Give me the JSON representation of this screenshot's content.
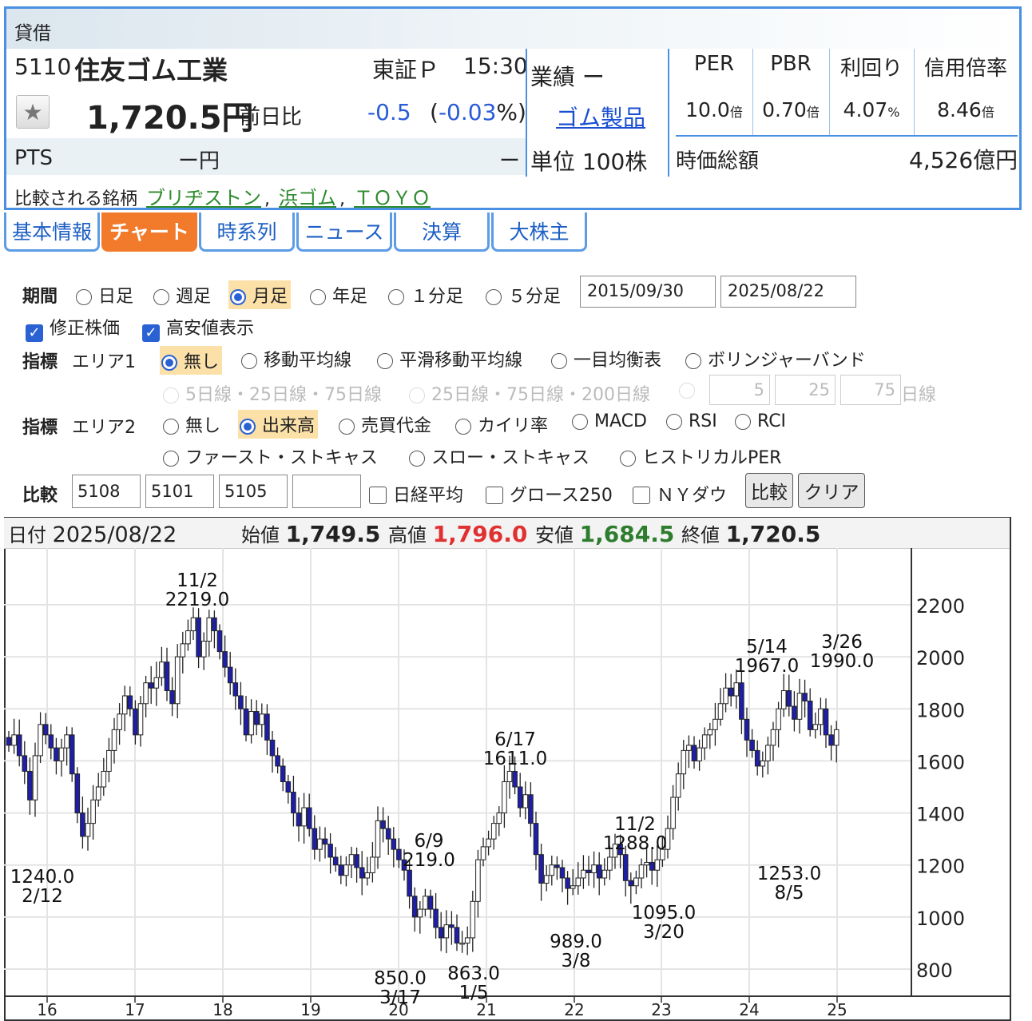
{
  "header": {
    "lending_label": "貸借",
    "code": "5110",
    "name": "住友ゴム工業",
    "exchange": "東証Ｐ",
    "time": "15:30",
    "price": "1,720.5円",
    "prev_label": "前日比",
    "change": "-0.5",
    "change_pct_open": "(",
    "change_pct": "-0.03",
    "change_pct_close": "%)",
    "pts_label": "PTS",
    "pts_value": "ー円",
    "pts_dash": "ー",
    "performance": "業績 ー",
    "sector": "ゴム製品",
    "unit": "単位 100株",
    "ratios": [
      {
        "label": "PER",
        "value": "10.0",
        "unit": "倍"
      },
      {
        "label": "PBR",
        "value": "0.70",
        "unit": "倍"
      },
      {
        "label": "利回り",
        "value": "4.07",
        "unit": "%"
      },
      {
        "label": "信用倍率",
        "value": "8.46",
        "unit": "倍"
      }
    ],
    "market_cap_label": "時価総額",
    "market_cap_value": "4,526億円",
    "compare_label": "比較される銘柄",
    "compare_links": [
      "ブリヂストン",
      "浜ゴム",
      "ＴＯＹＯ"
    ]
  },
  "tabs": [
    "基本情報",
    "チャート",
    "時系列",
    "ニュース",
    "決算",
    "大株主"
  ],
  "active_tab": "チャート",
  "options": {
    "period_label": "期間",
    "periods": [
      "日足",
      "週足",
      "月足",
      "年足",
      "１分足",
      "５分足"
    ],
    "selected_period": "月足",
    "date_from": "2015/09/30",
    "date_to": "2025/08/22",
    "adjusted_label": "修正株価",
    "highlow_label": "高安値表示",
    "indicator_label": "指標",
    "area1_label": "エリア1",
    "area1_options": [
      "無し",
      "移動平均線",
      "平滑移動平均線",
      "一目均衡表",
      "ボリンジャーバンド"
    ],
    "area1_selected": "無し",
    "ma_options": [
      "5日線・25日線・75日線",
      "25日線・75日線・200日線"
    ],
    "ma_values": [
      "5",
      "25",
      "75"
    ],
    "ma_suffix": "日線",
    "area2_label": "エリア2",
    "area2_options": [
      "無し",
      "出来高",
      "売買代金",
      "カイリ率",
      "MACD",
      "RSI",
      "RCI"
    ],
    "area2_options_row2": [
      "ファースト・ストキャス",
      "スロー・ストキャス",
      "ヒストリカルPER"
    ],
    "area2_selected": "出来高",
    "compare_label": "比較",
    "compare_codes": [
      "5108",
      "5101",
      "5105",
      ""
    ],
    "compare_indices": [
      "日経平均",
      "グロース250",
      "ＮＹダウ"
    ],
    "compare_button": "比較",
    "clear_button": "クリア"
  },
  "chart_header": {
    "date_label": "日付",
    "date": "2025/08/22",
    "open_label": "始値",
    "open": "1,749.5",
    "high_label": "高値",
    "high": "1,796.0",
    "low_label": "安値",
    "low": "1,684.5",
    "close_label": "終値",
    "close": "1,720.5"
  },
  "colors": {
    "accent": "#4a90e2",
    "up": "#ffffff",
    "down": "#1e1ea8",
    "high": "#e03030",
    "low": "#2e7d2e",
    "tab_active": "#f17a2b"
  },
  "chart_data": {
    "type": "candlestick",
    "timeframe": "monthly",
    "x_labels": [
      "16",
      "17",
      "18",
      "19",
      "20",
      "21",
      "22",
      "23",
      "24",
      "25"
    ],
    "ylim": [
      700,
      2500
    ],
    "yticks": [
      800,
      1000,
      1200,
      1400,
      1600,
      1800,
      2000,
      2200
    ],
    "annotations": [
      {
        "date": "11/2",
        "value": "2219.0",
        "price": 2219,
        "kind": "high"
      },
      {
        "date": "2/12",
        "value": "1240.0",
        "price": 1240,
        "kind": "low"
      },
      {
        "date": "6/9",
        "value": "219.0",
        "price": 1219,
        "kind": "high"
      },
      {
        "date": "3/17",
        "value": "850.0",
        "price": 850,
        "kind": "low"
      },
      {
        "date": "1/5",
        "value": "863.0",
        "price": 863,
        "kind": "low"
      },
      {
        "date": "6/17",
        "value": "1611.0",
        "price": 1611,
        "kind": "high"
      },
      {
        "date": "3/8",
        "value": "989.0",
        "price": 989,
        "kind": "low"
      },
      {
        "date": "11/2",
        "value": "1288.0",
        "price": 1288,
        "kind": "high"
      },
      {
        "date": "3/20",
        "value": "1095.0",
        "price": 1095,
        "kind": "low"
      },
      {
        "date": "5/14",
        "value": "1967.0",
        "price": 1967,
        "kind": "high"
      },
      {
        "date": "3/26",
        "value": "1990.0",
        "price": 1990,
        "kind": "high"
      },
      {
        "date": "8/5",
        "value": "1253.0",
        "price": 1253,
        "kind": "low"
      }
    ],
    "closes": [
      1660,
      1700,
      1620,
      1560,
      1450,
      1620,
      1740,
      1700,
      1650,
      1600,
      1650,
      1700,
      1550,
      1400,
      1310,
      1360,
      1450,
      1500,
      1560,
      1640,
      1720,
      1780,
      1850,
      1800,
      1700,
      1820,
      1900,
      1880,
      1920,
      1980,
      1870,
      1820,
      2000,
      2050,
      2100,
      2150,
      2000,
      2060,
      2150,
      2100,
      2020,
      1960,
      1900,
      1850,
      1800,
      1700,
      1790,
      1740,
      1780,
      1680,
      1620,
      1580,
      1520,
      1480,
      1400,
      1350,
      1420,
      1340,
      1260,
      1300,
      1280,
      1230,
      1200,
      1160,
      1200,
      1240,
      1190,
      1150,
      1170,
      1230,
      1370,
      1340,
      1300,
      1260,
      1220,
      1180,
      1080,
      1000,
      1030,
      1080,
      1030,
      960,
      920,
      970,
      960,
      900,
      900,
      920,
      1060,
      1220,
      1270,
      1300,
      1360,
      1400,
      1520,
      1560,
      1500,
      1420,
      1470,
      1360,
      1240,
      1130,
      1160,
      1200,
      1190,
      1150,
      1110,
      1120,
      1150,
      1180,
      1170,
      1200,
      1150,
      1180,
      1230,
      1280,
      1240,
      1140,
      1120,
      1150,
      1200,
      1210,
      1180,
      1220,
      1260,
      1340,
      1460,
      1550,
      1640,
      1660,
      1600,
      1650,
      1700,
      1720,
      1760,
      1820,
      1880,
      1850,
      1900,
      1760,
      1680,
      1640,
      1580,
      1600,
      1660,
      1720,
      1800,
      1870,
      1810,
      1760,
      1860,
      1830,
      1720,
      1740,
      1800,
      1700,
      1660,
      1720
    ]
  }
}
